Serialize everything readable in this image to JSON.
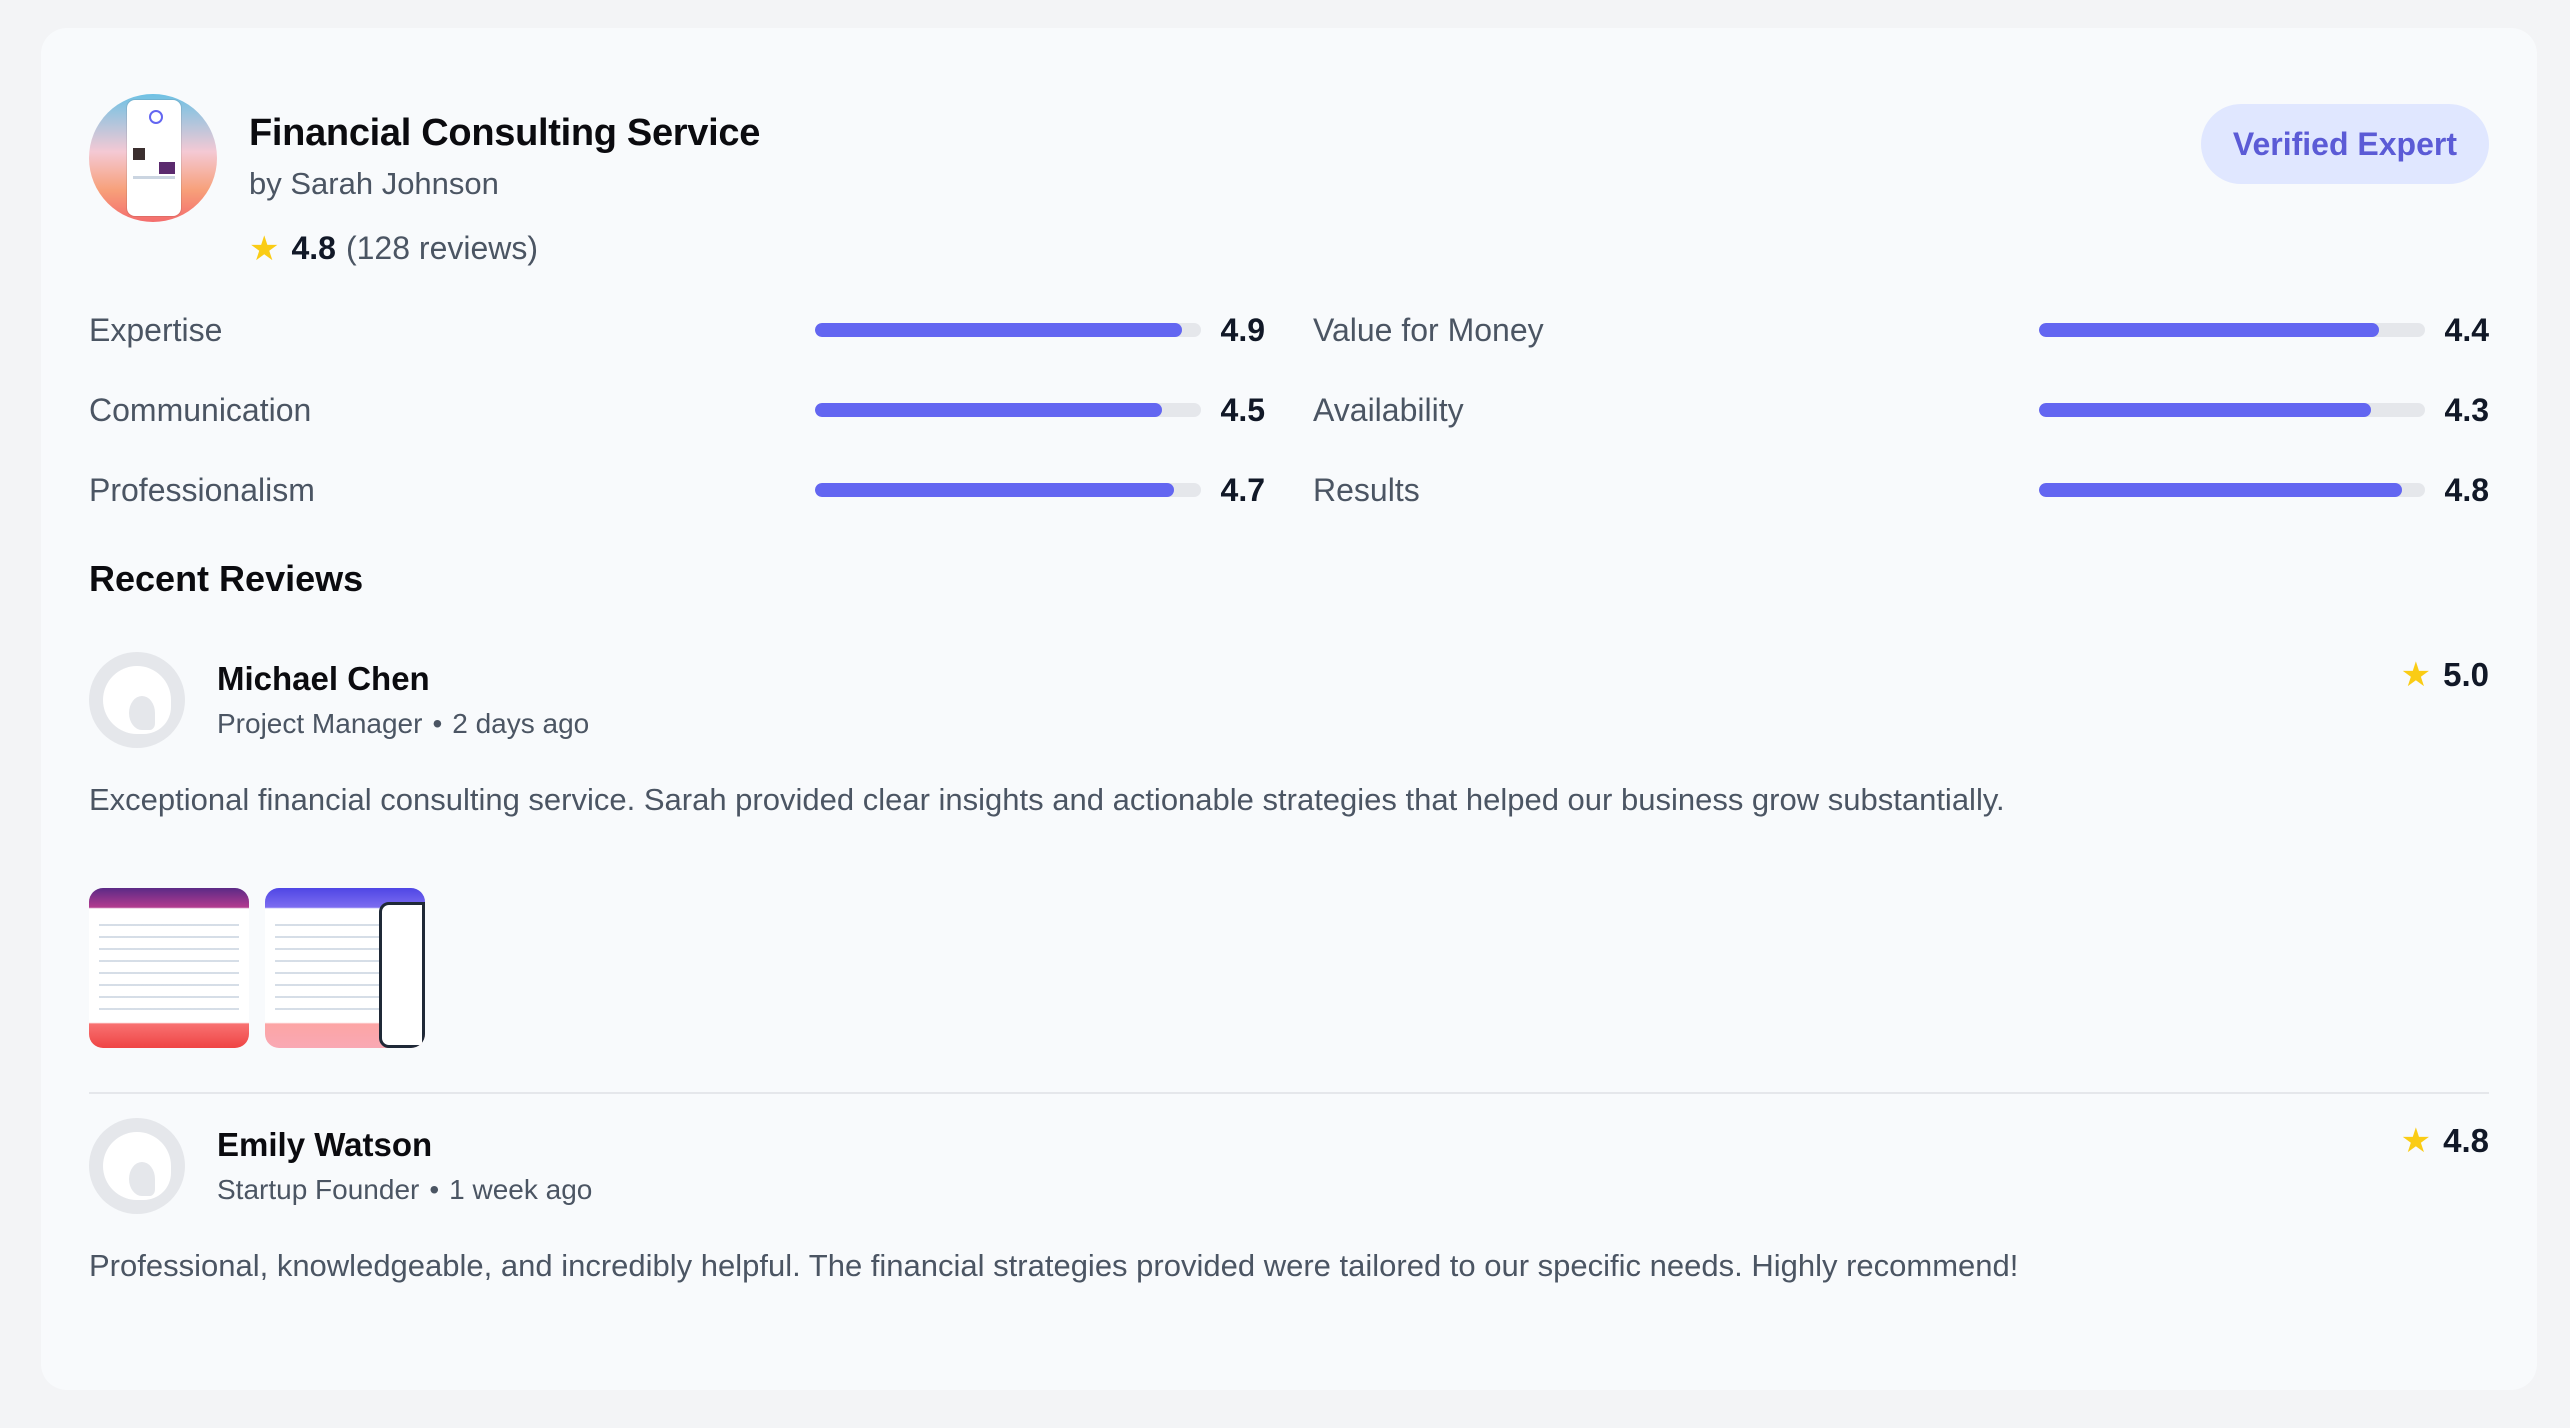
{
  "service": {
    "title": "Financial Consulting Service",
    "author": "by Sarah Johnson",
    "rating": "4.8",
    "review_count": "(128 reviews)",
    "badge": "Verified Expert"
  },
  "metrics": [
    {
      "label": "Expertise",
      "score": "4.9",
      "fraction": 0.95
    },
    {
      "label": "Value for Money",
      "score": "4.4",
      "fraction": 0.88
    },
    {
      "label": "Communication",
      "score": "4.5",
      "fraction": 0.9
    },
    {
      "label": "Availability",
      "score": "4.3",
      "fraction": 0.86
    },
    {
      "label": "Professionalism",
      "score": "4.7",
      "fraction": 0.93
    },
    {
      "label": "Results",
      "score": "4.8",
      "fraction": 0.94
    }
  ],
  "reviews_section": {
    "title": "Recent Reviews"
  },
  "reviews": [
    {
      "name": "Michael Chen",
      "role": "Project Manager",
      "time": "2 days ago",
      "rating": "5.0",
      "text": "Exceptional financial consulting service. Sarah provided clear insights and actionable strategies that helped our business grow substantially."
    },
    {
      "name": "Emily Watson",
      "role": "Startup Founder",
      "time": "1 week ago",
      "rating": "4.8",
      "text": "Professional, knowledgeable, and incredibly helpful. The financial strategies provided were tailored to our specific needs. Highly recommend!"
    }
  ],
  "colors": {
    "accent": "#6366f1",
    "badge_bg": "#e0e7ff",
    "star": "#facc15"
  },
  "icons": {
    "star": "star-icon",
    "avatar": "user-avatar-icon"
  }
}
